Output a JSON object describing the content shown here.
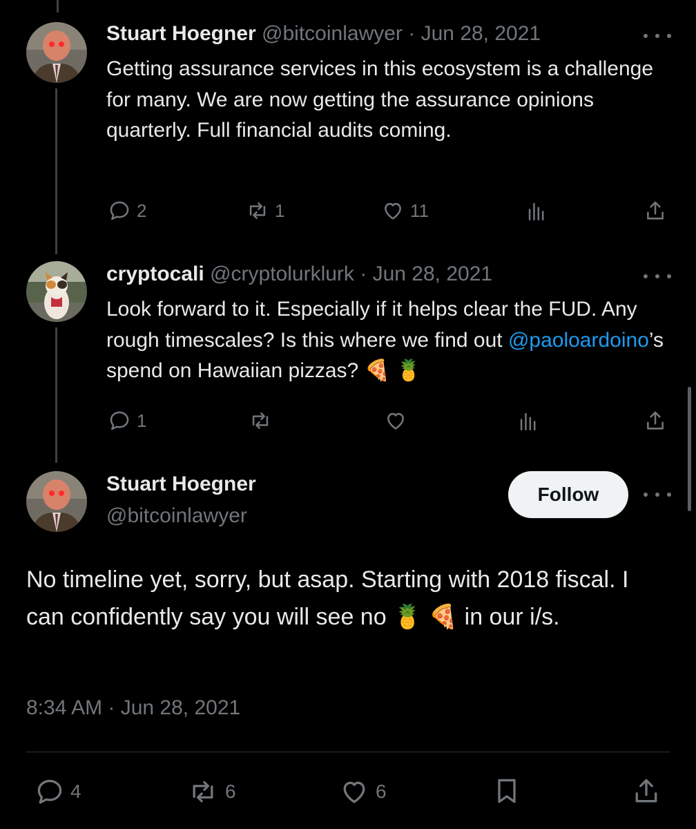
{
  "tweets": [
    {
      "name": "Stuart Hoegner",
      "handle": "@bitcoinlawyer",
      "dot": "·",
      "date": "Jun 28, 2021",
      "text": "Getting assurance services in this ecosystem is a challenge for many. We are now getting the assurance opinions quarterly. Full financial audits coming.",
      "replies": "2",
      "retweets": "1",
      "likes": "11"
    },
    {
      "name": "cryptocali",
      "handle": "@cryptolurklurk",
      "dot": "·",
      "date": "Jun 28, 2021",
      "text_line1": "Look forward to it. Especially if it helps clear the FUD. Any rough timescales? Is this where we find out ",
      "mention": "@paoloardoino",
      "text_line2": "’s spend on Hawaiian pizzas? ",
      "emoji": "🍕 🍍",
      "replies": "1",
      "retweets": "",
      "likes": ""
    }
  ],
  "main_tweet": {
    "name": "Stuart Hoegner",
    "handle": "@bitcoinlawyer",
    "follow_label": "Follow",
    "text_part1": "No timeline yet, sorry, but asap. Starting with 2018 fiscal. I can confidently say you will see no ",
    "emoji": "🍍 🍕",
    "text_part2": " in our i/s.",
    "timestamp": "8:34 AM · Jun 28, 2021",
    "replies": "4",
    "retweets": "6",
    "likes": "6"
  },
  "icons": {
    "reply": "reply-icon",
    "retweet": "retweet-icon",
    "like": "heart-icon",
    "views": "analytics-icon",
    "share": "share-icon",
    "bookmark": "bookmark-icon",
    "more": "more-icon"
  },
  "colors": {
    "background": "#000000",
    "text": "#e7e9ea",
    "muted": "#71767b",
    "link": "#1d9bf0",
    "follow_bg": "#eff3f4"
  }
}
